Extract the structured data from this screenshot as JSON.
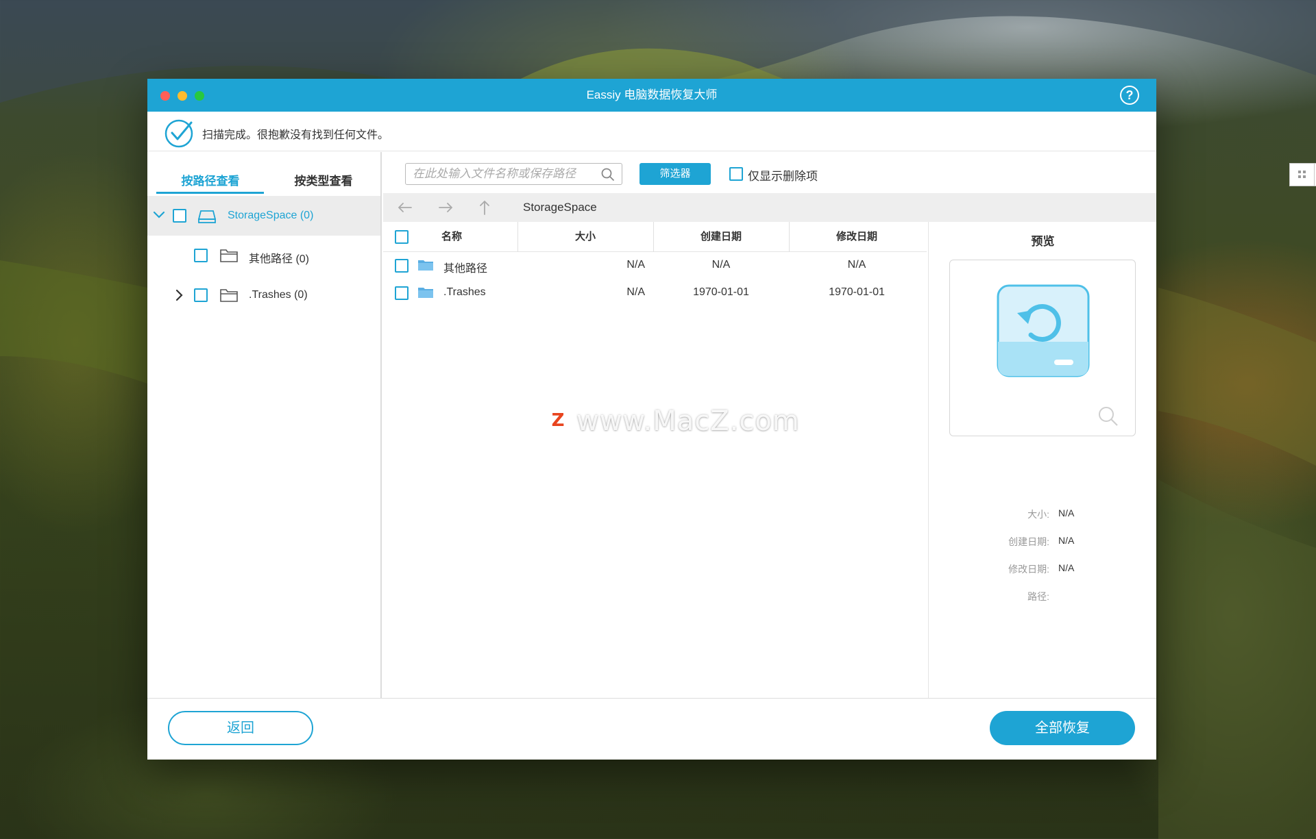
{
  "window": {
    "title": "Eassiy 电脑数据恢复大师",
    "help": "?"
  },
  "status": {
    "text": "扫描完成。很抱歉没有找到任何文件。"
  },
  "left_tabs": [
    {
      "label": "按路径查看",
      "active": true
    },
    {
      "label": "按类型查看",
      "active": false
    }
  ],
  "tree": [
    {
      "label": "StorageSpace (0)",
      "expanded": true,
      "selected": true
    },
    {
      "label": "其他路径 (0)",
      "expanded": false,
      "selected": false
    },
    {
      "label": ".Trashes (0)",
      "expanded": false,
      "selected": false
    }
  ],
  "toolbar": {
    "search_placeholder": "在此处输入文件名称或保存路径",
    "filter_label": "筛选器",
    "only_deleted_label": "仅显示删除项"
  },
  "path": {
    "current": "StorageSpace"
  },
  "table": {
    "headers": [
      "名称",
      "大小",
      "创建日期",
      "修改日期"
    ],
    "rows": [
      {
        "name": "其他路径",
        "size": "N/A",
        "created": "N/A",
        "modified": "N/A"
      },
      {
        "name": ".Trashes",
        "size": "N/A",
        "created": "1970-01-01",
        "modified": "1970-01-01"
      }
    ]
  },
  "preview": {
    "title": "预览",
    "meta": [
      {
        "label": "大小:",
        "value": "N/A"
      },
      {
        "label": "创建日期:",
        "value": "N/A"
      },
      {
        "label": "修改日期:",
        "value": "N/A"
      },
      {
        "label": "路径:",
        "value": ""
      }
    ]
  },
  "footer": {
    "back_label": "返回",
    "recover_all_label": "全部恢复"
  },
  "watermark": {
    "text": "www.MacZ.com",
    "logo": "Z"
  },
  "colors": {
    "accent": "#1ea4d4",
    "titlebar": "#1ea4d4"
  }
}
